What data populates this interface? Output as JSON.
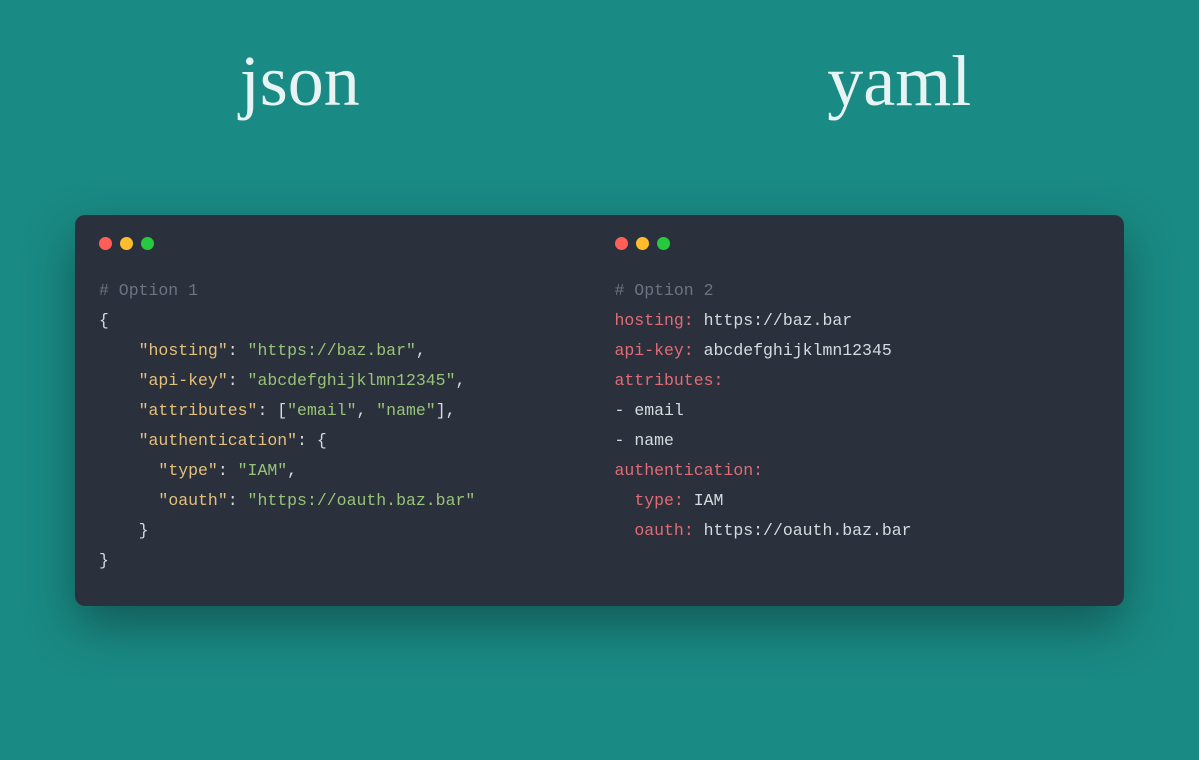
{
  "titles": {
    "left": "json",
    "right": "yaml"
  },
  "json": {
    "comment": "# Option 1",
    "open": "{",
    "k_hosting": "\"hosting\"",
    "v_hosting": "\"https://baz.bar\"",
    "k_apikey": "\"api-key\"",
    "v_apikey": "\"abcdefghijklmn12345\"",
    "k_attrs": "\"attributes\"",
    "v_attr_open": "[",
    "v_attr0": "\"email\"",
    "v_attr1": "\"name\"",
    "v_attr_close": "]",
    "k_auth": "\"authentication\"",
    "auth_open": "{",
    "k_type": "\"type\"",
    "v_type": "\"IAM\"",
    "k_oauth": "\"oauth\"",
    "v_oauth": "\"https://oauth.baz.bar\"",
    "auth_close": "}",
    "close": "}",
    "colon_sp": ": ",
    "comma": ",",
    "ind1": "    ",
    "ind2": "      "
  },
  "yaml": {
    "comment": "# Option 2",
    "k_hosting": "hosting:",
    "v_hosting": "https://baz.bar",
    "k_apikey": "api-key:",
    "v_apikey": "abcdefghijklmn12345",
    "k_attrs": "attributes:",
    "dash": "- ",
    "attr0": "email",
    "attr1": "name",
    "k_auth": "authentication:",
    "k_type": "type:",
    "v_type": "IAM",
    "k_oauth": "oauth:",
    "v_oauth": "https://oauth.baz.bar",
    "ind": "  "
  }
}
